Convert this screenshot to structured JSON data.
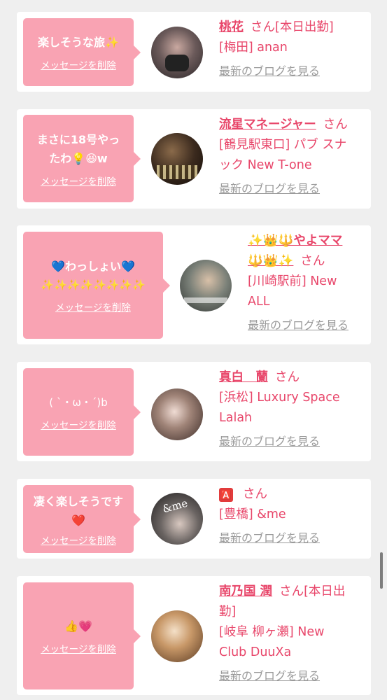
{
  "cards": [
    {
      "message_lines": [
        "楽しそうな旅✨"
      ],
      "delete_label": "メッセージを削除",
      "name": "桃花",
      "san": "さん[本日出勤]",
      "area": "[梅田] anan",
      "blog": "最新のブログを見る"
    },
    {
      "message_lines": [
        "まさに18号やっ",
        "たわ💡😆w"
      ],
      "delete_label": "メッセージを削除",
      "name": "流星マネージャー",
      "san": "さん",
      "area_lines": [
        "[鶴見駅東口] パブ スナ",
        "ック New T-one"
      ],
      "blog": "最新のブログを見る"
    },
    {
      "message_lines": [
        "💙わっしょい💙",
        "✨✨✨✨✨✨✨✨"
      ],
      "delete_label": "メッセージを削除",
      "name_lines": [
        "✨👑🔱やよママ",
        "🔱👑✨"
      ],
      "san": "さん",
      "area_lines": [
        "[川崎駅前] New",
        "ALL"
      ],
      "blog": "最新のブログを見る"
    },
    {
      "message_lines": [
        "( ˋ・ω・ˊ)b"
      ],
      "delete_label": "メッセージを削除",
      "name": "真白　蘭",
      "san": "さん",
      "area_lines": [
        "[浜松] Luxury Space",
        "Lalah"
      ],
      "blog": "最新のブログを見る"
    },
    {
      "message_lines": [
        "凄く楽しそうです",
        "❤️"
      ],
      "delete_label": "メッセージを削除",
      "name": "🅰️",
      "san": "さん",
      "area": "[豊橋] &me",
      "avatar_text": "&me",
      "blog": "最新のブログを見る"
    },
    {
      "message_lines": [
        "👍💗"
      ],
      "delete_label": "メッセージを削除",
      "name": "南乃国 潤",
      "san_lines": [
        "さん[本日出",
        "勤]"
      ],
      "area_lines": [
        "[岐阜 柳ヶ瀬] New",
        "Club DuuXa"
      ],
      "blog": "最新のブログを見る"
    }
  ],
  "colors": {
    "accent": "#e8466a",
    "bubble": "#f9a3b3",
    "link_gray": "#9a9a9a",
    "background": "#efefef"
  }
}
